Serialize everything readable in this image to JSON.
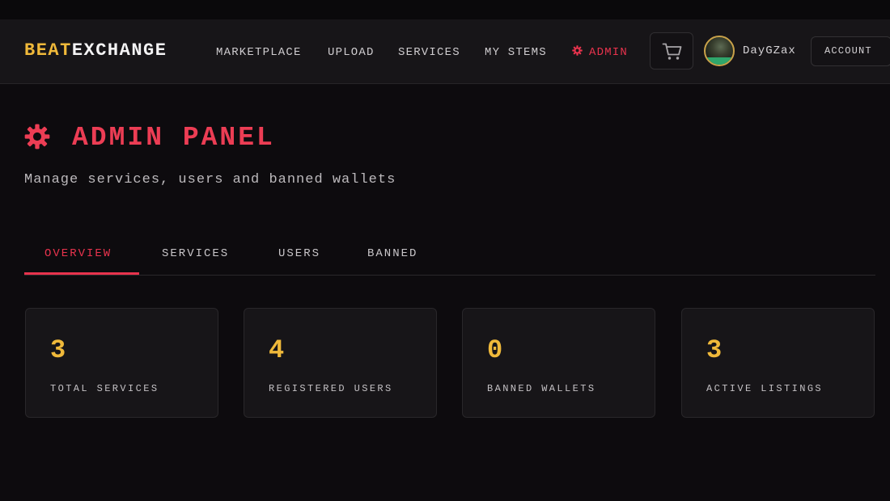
{
  "brand": {
    "part1": "BEAT",
    "part2": "EXCHANGE"
  },
  "nav": {
    "marketplace": "MARKETPLACE",
    "upload": "UPLOAD",
    "services": "SERVICES",
    "my_stems": "MY STEMS",
    "admin": "ADMIN",
    "admin_icon": "gear-icon"
  },
  "header_actions": {
    "cart_icon": "cart-icon",
    "username": "DayGZax",
    "account_label": "ACCOUNT"
  },
  "page": {
    "title": "ADMIN PANEL",
    "title_icon": "gear-icon",
    "subtitle": "Manage services, users and banned wallets"
  },
  "tabs": [
    {
      "label": "OVERVIEW",
      "active": true
    },
    {
      "label": "SERVICES",
      "active": false
    },
    {
      "label": "USERS",
      "active": false
    },
    {
      "label": "BANNED",
      "active": false
    }
  ],
  "stats": [
    {
      "value": "3",
      "label": "TOTAL SERVICES"
    },
    {
      "value": "4",
      "label": "REGISTERED USERS"
    },
    {
      "value": "0",
      "label": "BANNED WALLETS"
    },
    {
      "value": "3",
      "label": "ACTIVE LISTINGS"
    }
  ],
  "colors": {
    "accent_red": "#e8334d",
    "accent_gold": "#f0b93a",
    "background": "#0d0b0e",
    "surface": "#171518"
  }
}
